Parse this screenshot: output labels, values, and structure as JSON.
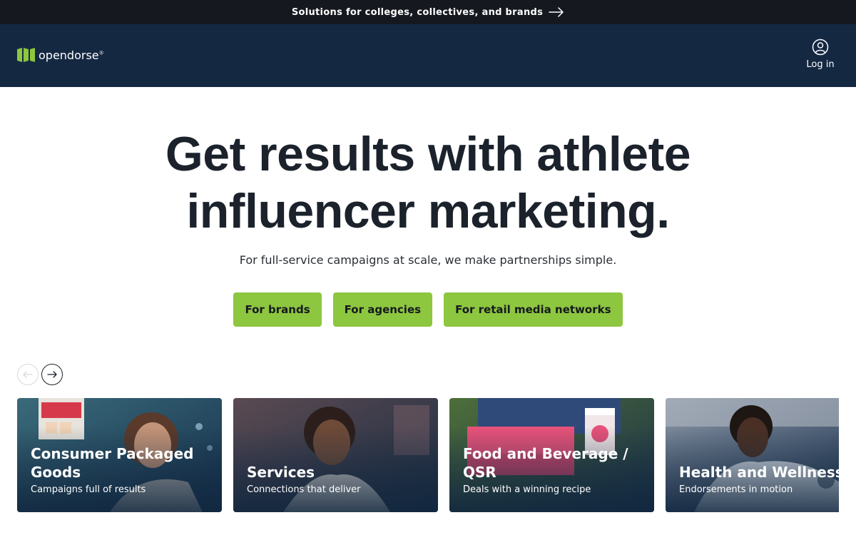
{
  "announcement": {
    "text": "Solutions for colleges, collectives, and brands",
    "icon": "arrow-right-icon"
  },
  "header": {
    "logo_text": "opendorse",
    "logo_mark": "®",
    "login_label": "Log in",
    "login_icon": "user-circle-icon"
  },
  "hero": {
    "headline_line1": "Get results with athlete",
    "headline_line2": "influencer marketing.",
    "subheadline": "For full-service campaigns at scale, we make partnerships simple.",
    "buttons": [
      "For brands",
      "For agencies",
      "For retail media networks"
    ]
  },
  "carousel": {
    "prev_icon": "arrow-left-icon",
    "next_icon": "arrow-right-icon",
    "cards": [
      {
        "title": "Consumer Packaged Goods",
        "subtitle": "Campaigns full of results"
      },
      {
        "title": "Services",
        "subtitle": "Connections that deliver"
      },
      {
        "title": "Food and Beverage / QSR",
        "subtitle": "Deals with a winning recipe"
      },
      {
        "title": "Health and Wellness",
        "subtitle": "Endorsements in motion"
      }
    ]
  },
  "colors": {
    "brand_green": "#8dc63f",
    "nav_navy": "#142842",
    "topbar_black": "#15191f",
    "text_dark": "#1b222b"
  }
}
